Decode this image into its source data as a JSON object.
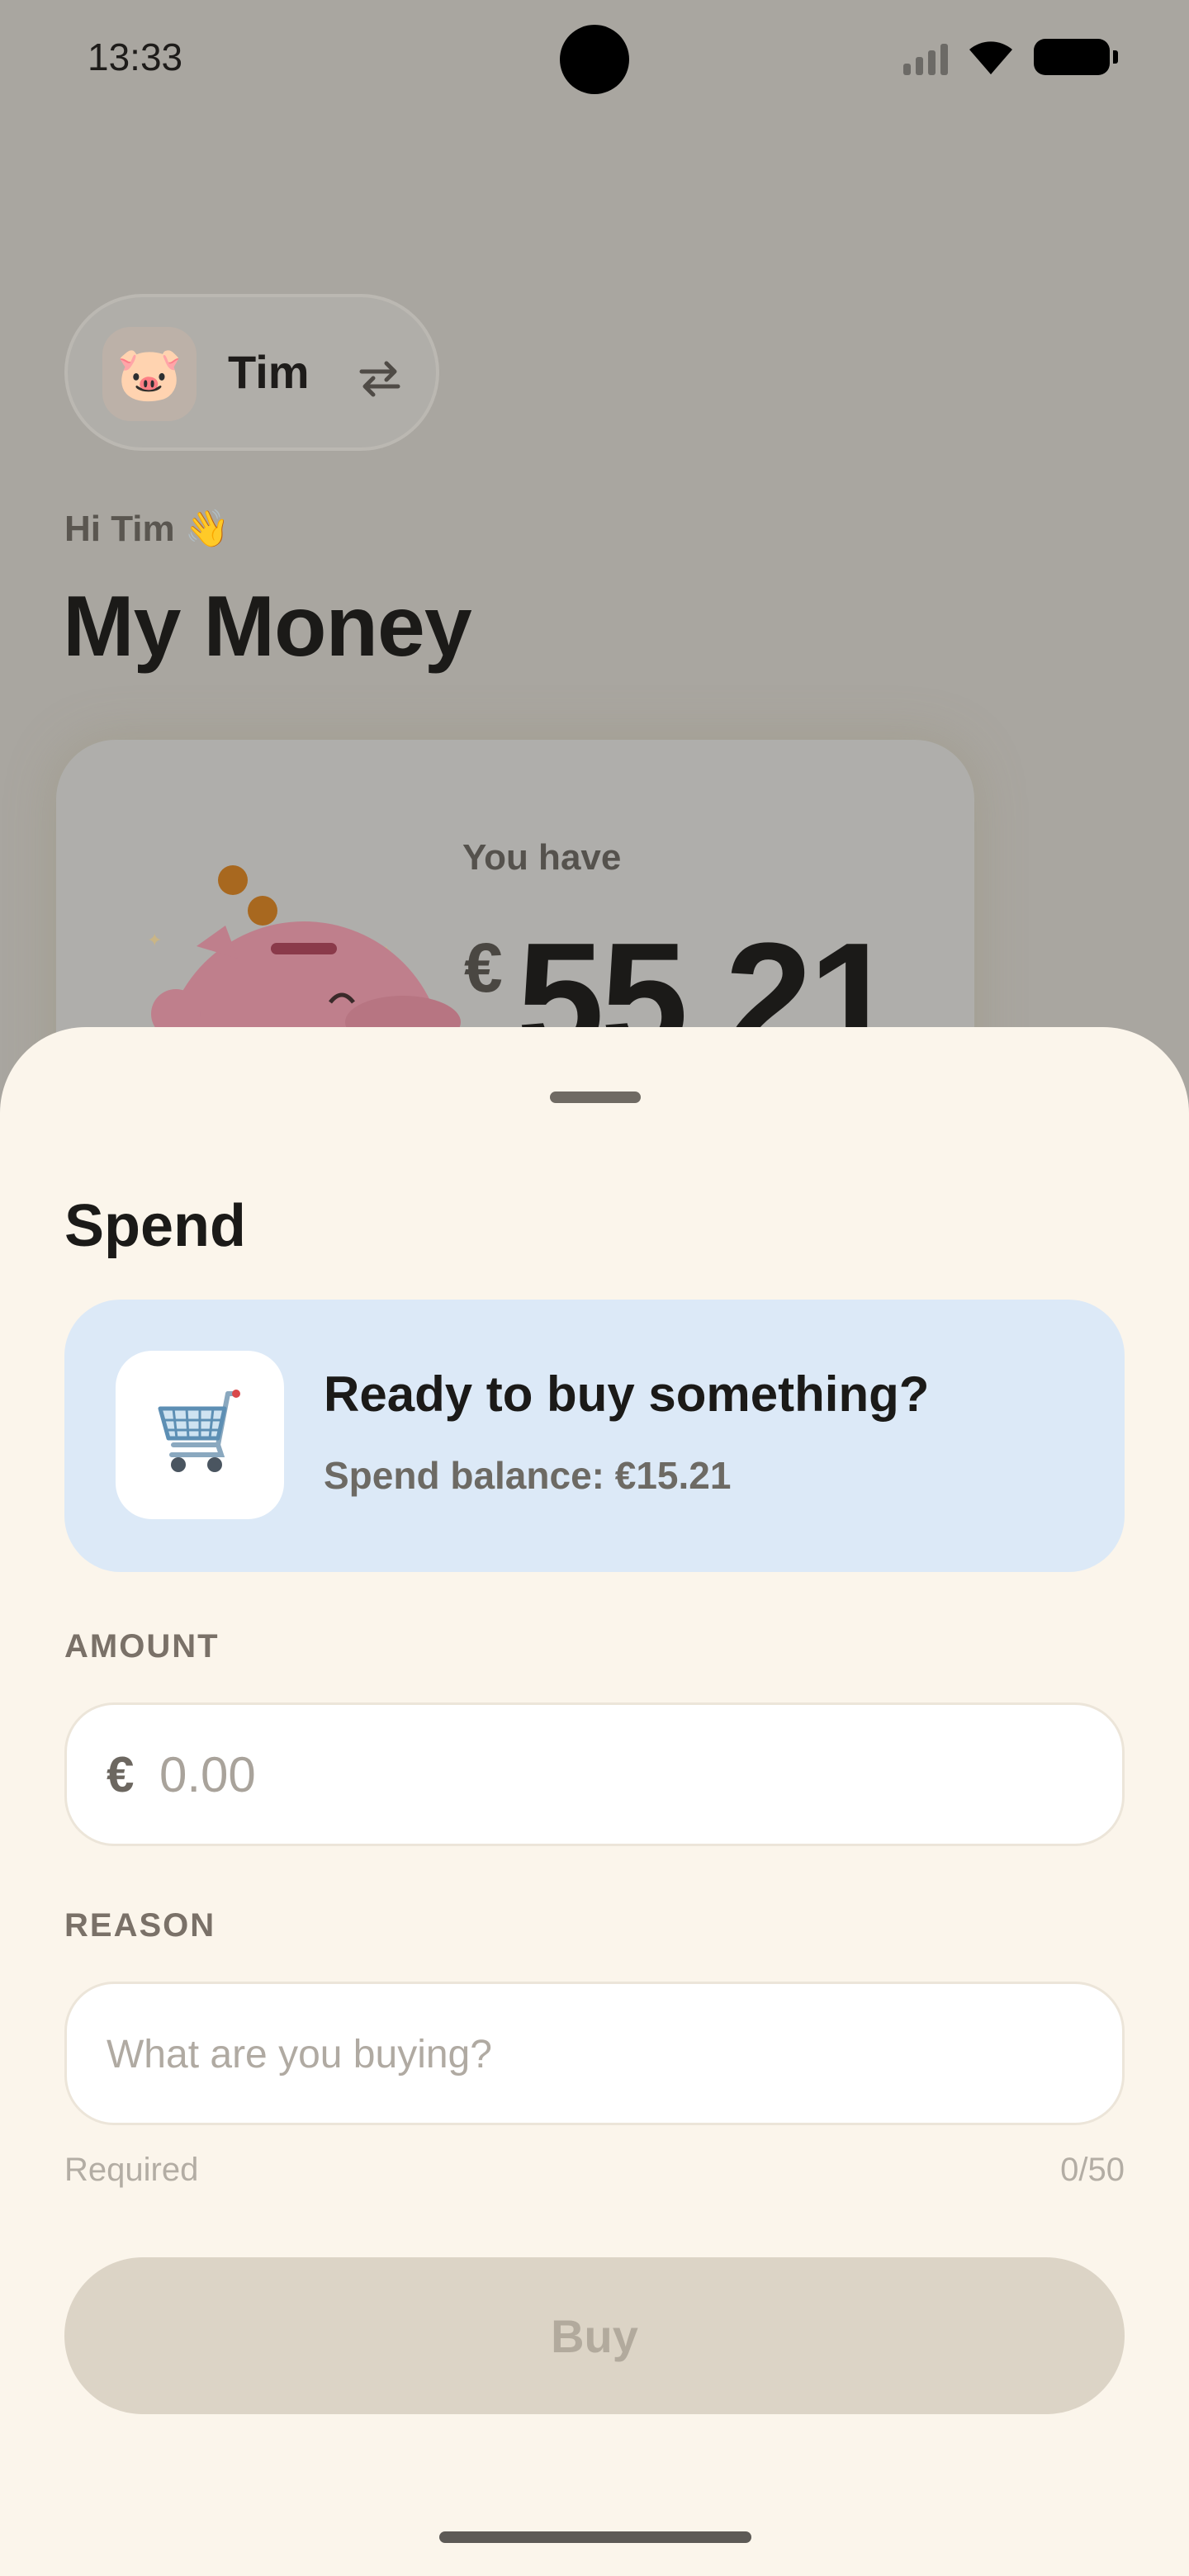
{
  "status_bar": {
    "time": "13:33"
  },
  "profile": {
    "name": "Tim",
    "avatar_emoji": "🐷"
  },
  "header": {
    "greeting": "Hi Tim 👋",
    "title": "My Money"
  },
  "balance_card": {
    "label": "You have",
    "currency": "€",
    "amount": "55.21"
  },
  "sheet": {
    "title": "Spend",
    "info": {
      "heading": "Ready to buy something?",
      "subtext": "Spend balance: €15.21"
    },
    "amount": {
      "label": "AMOUNT",
      "currency": "€",
      "placeholder": "0.00"
    },
    "reason": {
      "label": "REASON",
      "placeholder": "What are you buying?",
      "helper": "Required",
      "counter": "0/50"
    },
    "buy_label": "Buy"
  },
  "colors": {
    "sheet_bg": "#fbf5eb",
    "info_bg": "#dce9f7",
    "buy_disabled": "#dcd4c6"
  }
}
